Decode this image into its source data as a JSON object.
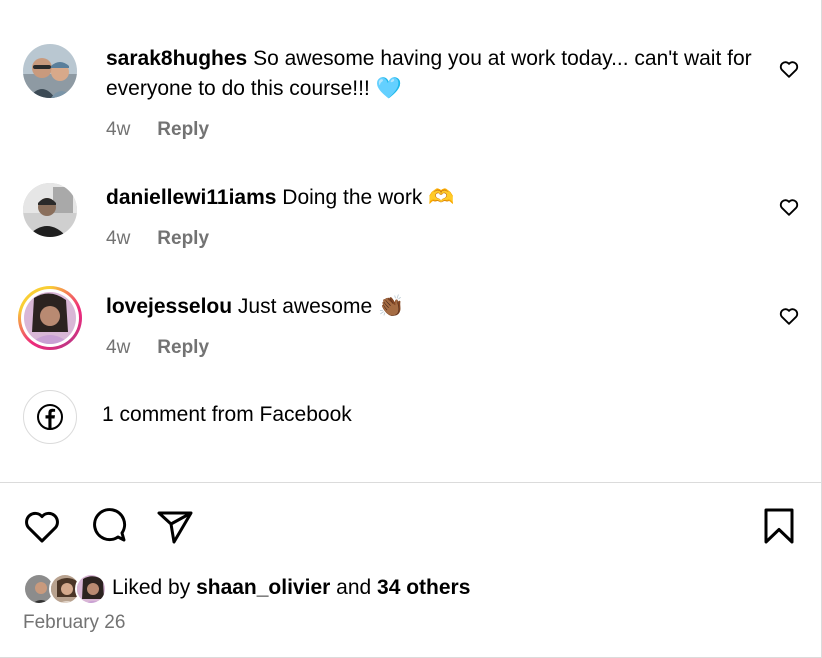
{
  "comments": [
    {
      "username": "sarak8hughes",
      "text": "So awesome having you at work today... can't wait for everyone to do this course!!!",
      "emoji": "🩵",
      "age": "4w",
      "reply_label": "Reply",
      "avatar_icon": "user-photo"
    },
    {
      "username": "daniellewi11iams",
      "text": "Doing the work",
      "emoji": "🫶",
      "age": "4w",
      "reply_label": "Reply",
      "avatar_icon": "user-photo"
    },
    {
      "username": "lovejesselou",
      "text": "Just awesome",
      "emoji": "👏🏾",
      "age": "4w",
      "reply_label": "Reply",
      "avatar_icon": "user-photo-story-ring"
    }
  ],
  "facebook": {
    "label": "1 comment from Facebook",
    "icon": "facebook-icon"
  },
  "actions": {
    "like_icon": "heart-icon",
    "comment_icon": "comment-icon",
    "share_icon": "send-icon",
    "save_icon": "bookmark-icon"
  },
  "likes": {
    "prefix": "Liked by",
    "user": "shaan_olivier",
    "connector": "and",
    "others": "34 others"
  },
  "post_date": "February 26",
  "colors": {
    "text": "#000000",
    "secondary": "#737373",
    "divider": "#dbdbdb",
    "story_ring_start": "#f9ce34",
    "story_ring_end": "#ee2a7b"
  }
}
